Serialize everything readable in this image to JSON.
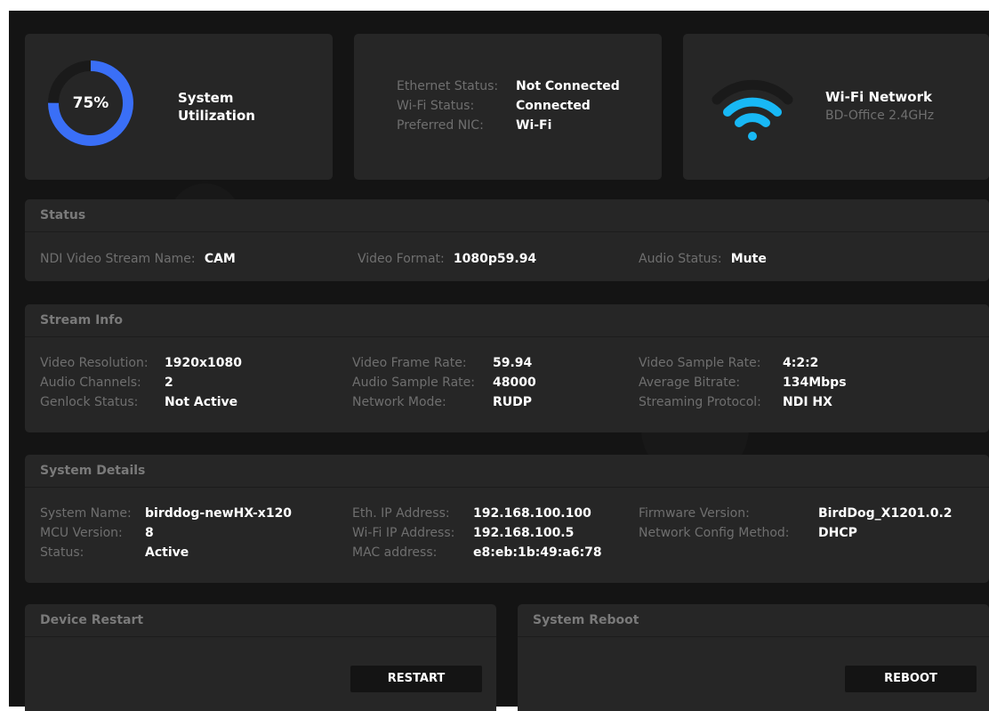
{
  "utilization": {
    "percent_label": "75%",
    "percent": 75,
    "title_line1": "System",
    "title_line2": "Utilization"
  },
  "network": {
    "rows": [
      {
        "label": "Ethernet Status:",
        "value": "Not Connected"
      },
      {
        "label": "Wi-Fi Status:",
        "value": "Connected"
      },
      {
        "label": "Preferred NIC:",
        "value": "Wi-Fi"
      }
    ]
  },
  "wifi": {
    "title": "Wi-Fi Network",
    "ssid": "BD-Office 2.4GHz",
    "icon": "wifi-icon"
  },
  "status": {
    "header": "Status",
    "stream_name_label": "NDI Video Stream Name:",
    "stream_name": "CAM",
    "video_format_label": "Video Format:",
    "video_format": "1080p59.94",
    "audio_status_label": "Audio Status:",
    "audio_status": "Mute"
  },
  "stream_info": {
    "header": "Stream Info",
    "col1": [
      {
        "label": "Video Resolution:",
        "value": "1920x1080"
      },
      {
        "label": "Audio Channels:",
        "value": "2"
      },
      {
        "label": "Genlock Status:",
        "value": "Not Active"
      }
    ],
    "col2": [
      {
        "label": "Video Frame Rate:",
        "value": "59.94"
      },
      {
        "label": "Audio Sample Rate:",
        "value": "48000"
      },
      {
        "label": "Network Mode:",
        "value": "RUDP"
      }
    ],
    "col3": [
      {
        "label": "Video Sample Rate:",
        "value": "4:2:2"
      },
      {
        "label": "Average Bitrate:",
        "value": "134Mbps"
      },
      {
        "label": "Streaming Protocol:",
        "value": "NDI HX"
      }
    ]
  },
  "system_details": {
    "header": "System Details",
    "col1": [
      {
        "label": "System Name:",
        "value": "birddog-newHX-x120"
      },
      {
        "label": "MCU Version:",
        "value": "8"
      },
      {
        "label": "Status:",
        "value": "Active"
      }
    ],
    "col2": [
      {
        "label": "Eth. IP Address:",
        "value": "192.168.100.100"
      },
      {
        "label": "Wi-Fi IP Address:",
        "value": "192.168.100.5"
      },
      {
        "label": "MAC address:",
        "value": "e8:eb:1b:49:a6:78"
      }
    ],
    "col3": [
      {
        "label": "Firmware Version:",
        "value": "BirdDog_X1201.0.2"
      },
      {
        "label": "Network Config Method:",
        "value": "DHCP"
      }
    ]
  },
  "device_restart": {
    "header": "Device Restart",
    "button": "RESTART"
  },
  "system_reboot": {
    "header": "System Reboot",
    "button": "REBOOT"
  },
  "colors": {
    "accent": "#3a6ff7",
    "wifi": "#18b8f5",
    "ring_bg": "#1a1a1a",
    "card": "#262626",
    "bg": "#141414"
  }
}
